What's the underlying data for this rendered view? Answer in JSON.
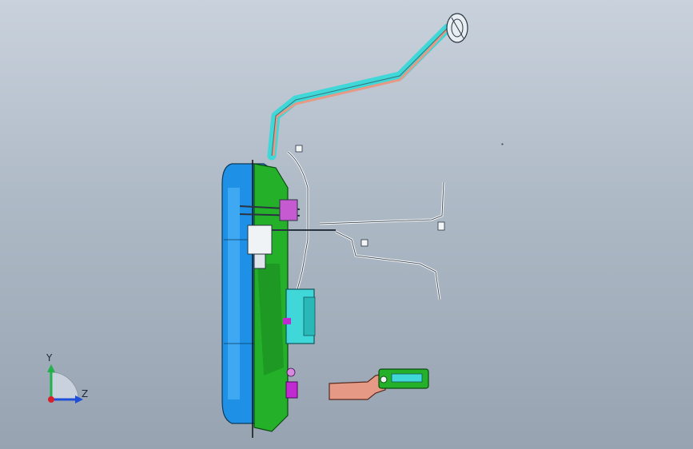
{
  "viewport": {
    "background_top": "#c9d2dc",
    "background_bottom": "#97a3b1"
  },
  "triad": {
    "y_label": "Y",
    "z_label": "Z",
    "y_color": "#22b14c",
    "z_color": "#1f4fd8",
    "x_color": "#d81f2a"
  },
  "model": {
    "tank_color": "#1e90e6",
    "green_color": "#25b02a",
    "cyan_color": "#3fd7d7",
    "salmon_color": "#e69a86",
    "magenta_color": "#c02ad0"
  }
}
